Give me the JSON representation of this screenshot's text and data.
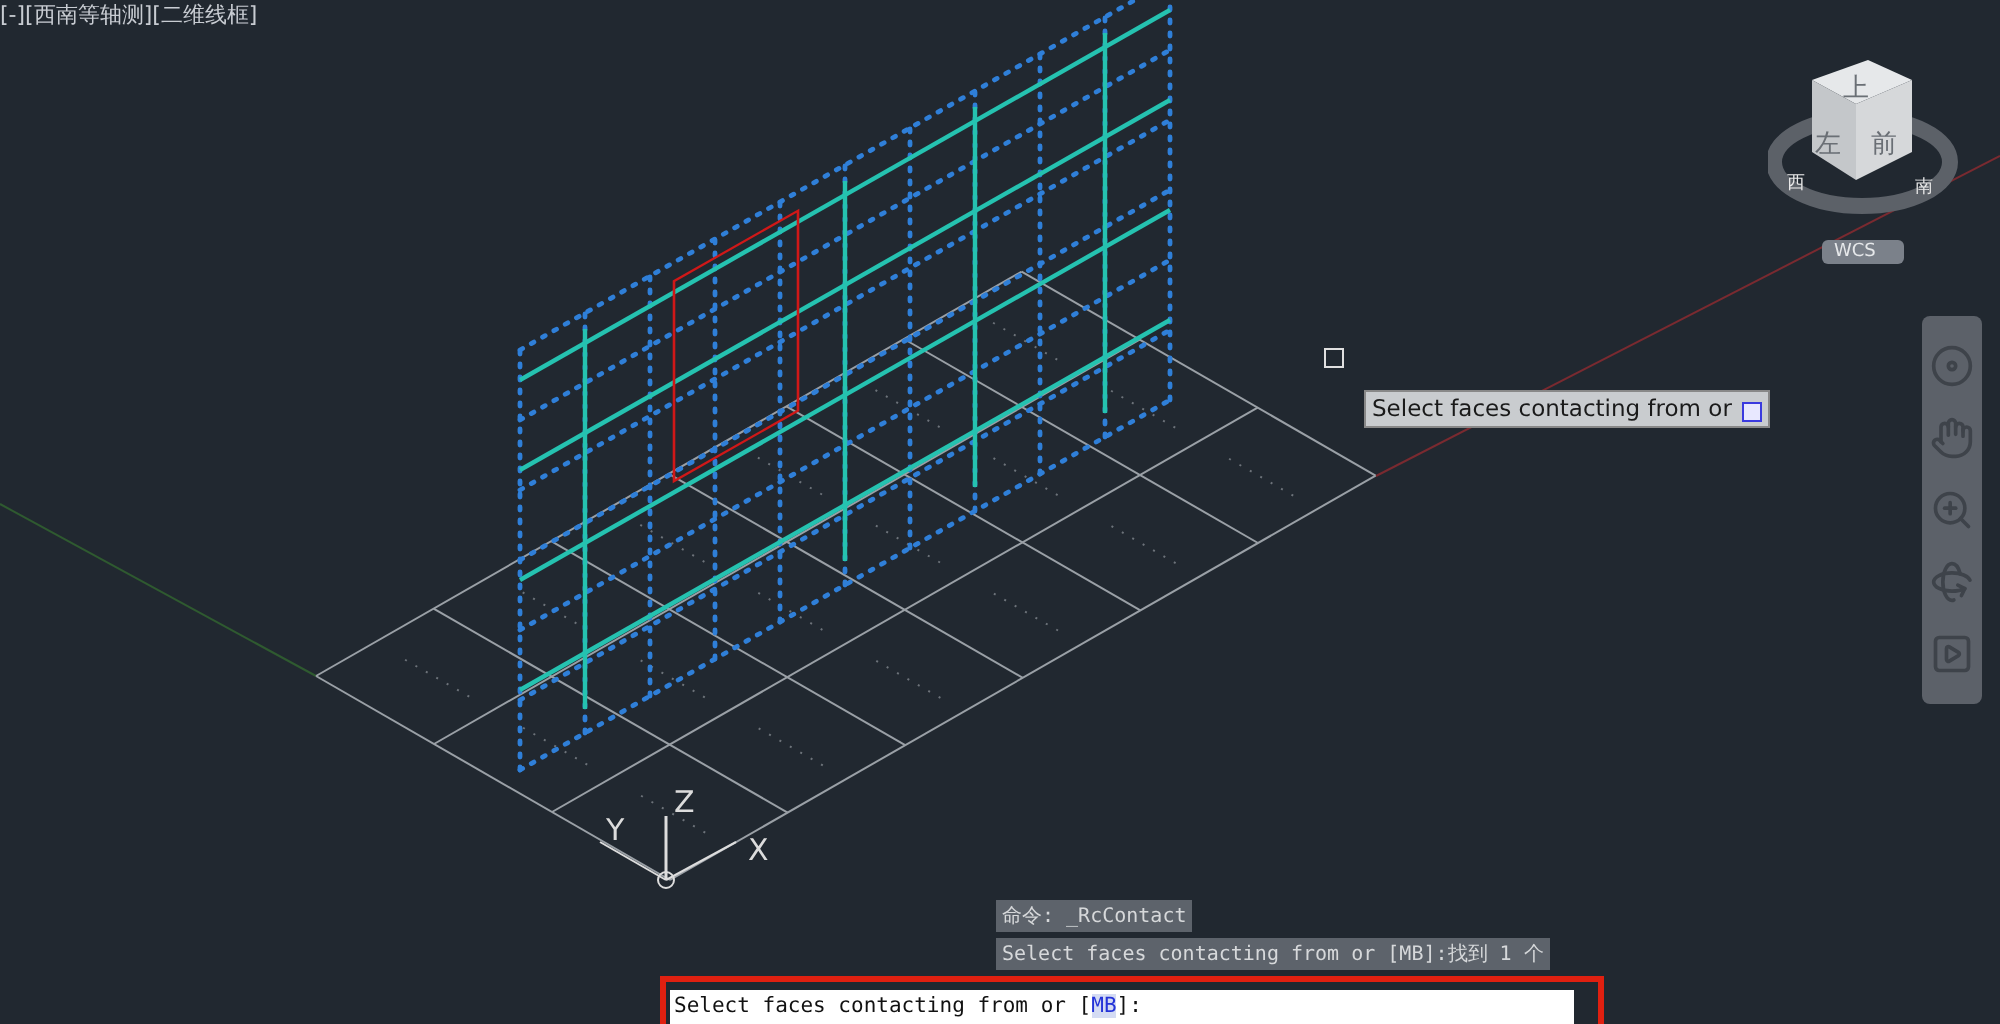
{
  "viewport": {
    "label": "[-][西南等轴测][二维线框]"
  },
  "viewcube": {
    "faces": [
      {
        "kind": "top",
        "text": "上"
      },
      {
        "kind": "left",
        "text": "左"
      },
      {
        "kind": "front",
        "text": "前"
      }
    ],
    "compass": [
      {
        "kind": "left",
        "text": "西"
      },
      {
        "kind": "right",
        "text": "南"
      }
    ],
    "coordinate_system": "WCS"
  },
  "ucs": {
    "x": "X",
    "y": "Y",
    "z": "Z"
  },
  "tooltip": {
    "text": "Select faces contacting from or"
  },
  "history": [
    "命令: _RcContact",
    "Select faces contacting from or [MB]:找到 1 个"
  ],
  "command": {
    "prompt": "Select faces contacting from or [",
    "option": "MB",
    "suffix": "]:"
  }
}
